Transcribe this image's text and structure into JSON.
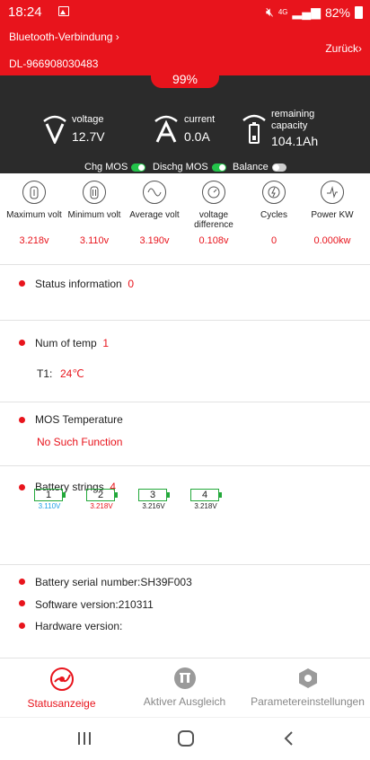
{
  "statusbar": {
    "time": "18:24",
    "network": "4G",
    "battery": "82%"
  },
  "header": {
    "bluetooth_link": "Bluetooth-Verbindung",
    "device_id": "DL-966908030483",
    "back": "Zurück"
  },
  "panel": {
    "soc": "99%",
    "voltage_label": "voltage",
    "voltage_value": "12.7V",
    "current_label": "current",
    "current_value": "0.0A",
    "capacity_label": "remaining capacity",
    "capacity_value": "104.1Ah",
    "chg_mos_label": "Chg MOS",
    "chg_mos_on": true,
    "dischg_mos_label": "Dischg MOS",
    "dischg_mos_on": true,
    "balance_label": "Balance",
    "balance_on": false
  },
  "stats": [
    {
      "label": "Maximum volt",
      "value": "3.218v",
      "icon": "battery-max-icon"
    },
    {
      "label": "Minimum volt",
      "value": "3.110v",
      "icon": "battery-min-icon"
    },
    {
      "label": "Average volt",
      "value": "3.190v",
      "icon": "sine-wave-icon"
    },
    {
      "label": "voltage difference",
      "value": "0.108v",
      "icon": "gauge-icon"
    },
    {
      "label": "Cycles",
      "value": "0",
      "icon": "cycle-icon"
    },
    {
      "label": "Power KW",
      "value": "0.000kw",
      "icon": "power-icon"
    }
  ],
  "status_info": {
    "label": "Status information",
    "count": "0"
  },
  "temp": {
    "label": "Num of temp",
    "count": "1",
    "t1_label": "T1:",
    "t1_value": "24℃"
  },
  "mos_temp": {
    "label": "MOS Temperature",
    "value": "No Such Function"
  },
  "strings": {
    "label": "Battery strings",
    "count": "4",
    "cells": [
      {
        "num": "1",
        "volt": "3.110V",
        "color": "#1ea0e6"
      },
      {
        "num": "2",
        "volt": "3.218V",
        "color": "#e8141c"
      },
      {
        "num": "3",
        "volt": "3.216V",
        "color": "#222222"
      },
      {
        "num": "4",
        "volt": "3.218V",
        "color": "#222222"
      }
    ]
  },
  "info": {
    "serial": "Battery serial number:SH39F003",
    "software": "Software version:210311",
    "hardware": "Hardware version:"
  },
  "tabs": [
    {
      "label": "Statusanzeige",
      "active": true
    },
    {
      "label": "Aktiver Ausgleich",
      "active": false
    },
    {
      "label": "Parametereinstellungen",
      "active": false
    }
  ],
  "colors": {
    "accent": "#e8141c",
    "panel": "#2b2b2b",
    "toggle_on": "#23c44a",
    "cell_border": "#23a83a"
  }
}
